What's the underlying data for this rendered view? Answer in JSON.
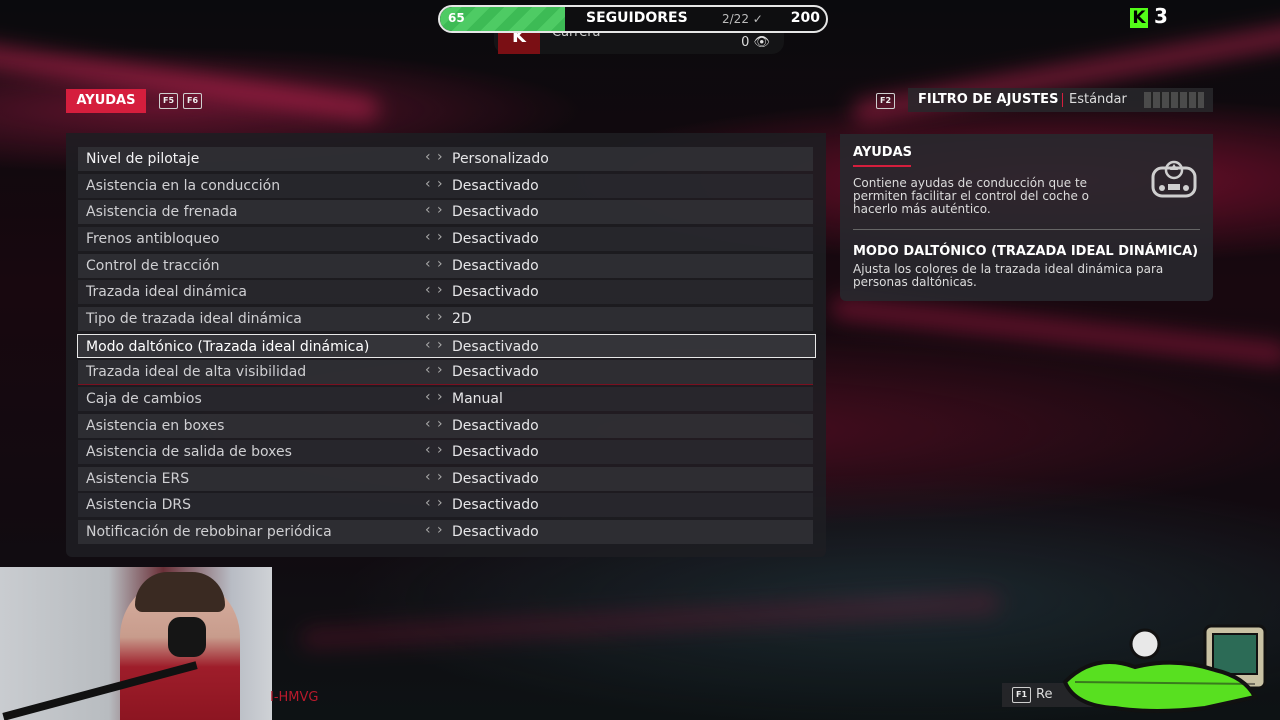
{
  "overlay": {
    "followers": {
      "label": "SEGUIDORES",
      "current": "65",
      "goal": "200",
      "progress_text": "2/22",
      "progress_fraction": 0.325
    },
    "race": {
      "logo_letter": "K",
      "label": "Carrera",
      "count": "0"
    },
    "kick_count": "3",
    "stream_tag": "I-HMVG"
  },
  "header": {
    "tab_label": "AYUDAS",
    "keys": [
      "F5",
      "F6"
    ],
    "filter_key": "F2",
    "filter_label": "FILTRO DE AJUSTES",
    "filter_value": "Estándar"
  },
  "settings": [
    {
      "label": "Nivel de pilotaje",
      "value": "Personalizado"
    },
    {
      "label": "Asistencia en la conducción",
      "value": "Desactivado"
    },
    {
      "label": "Asistencia de frenada",
      "value": "Desactivado"
    },
    {
      "label": "Frenos antibloqueo",
      "value": "Desactivado"
    },
    {
      "label": "Control de tracción",
      "value": "Desactivado"
    },
    {
      "label": "Trazada ideal dinámica",
      "value": "Desactivado"
    },
    {
      "label": "Tipo de trazada ideal dinámica",
      "value": "2D"
    },
    {
      "label": "Modo daltónico (Trazada ideal dinámica)",
      "value": "Desactivado"
    },
    {
      "label": "Trazada ideal de alta visibilidad",
      "value": "Desactivado"
    },
    {
      "label": "Caja de cambios",
      "value": "Manual"
    },
    {
      "label": "Asistencia en boxes",
      "value": "Desactivado"
    },
    {
      "label": "Asistencia de salida de boxes",
      "value": "Desactivado"
    },
    {
      "label": "Asistencia ERS",
      "value": "Desactivado"
    },
    {
      "label": "Asistencia DRS",
      "value": "Desactivado"
    },
    {
      "label": "Notificación de rebobinar periódica",
      "value": "Desactivado"
    }
  ],
  "selected_index": 7,
  "help": {
    "section_title": "AYUDAS",
    "section_text": "Contiene ayudas de conducción que te permiten facilitar el control del coche o hacerlo más auténtico.",
    "item_title": "MODO DALTÓNICO (TRAZADA IDEAL DINÁMICA)",
    "item_text": "Ajusta los colores de la trazada ideal dinámica para personas daltónicas."
  },
  "footer": {
    "key": "F1",
    "label": "Re"
  },
  "colors": {
    "accent": "#d51e3d",
    "kick": "#53fc18",
    "progress": "#3dbb55"
  }
}
